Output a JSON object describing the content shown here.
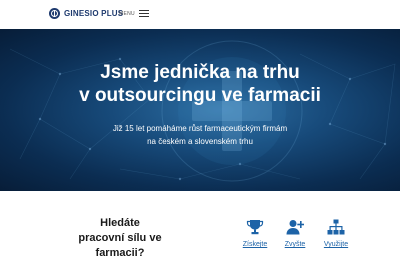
{
  "header": {
    "logo_text": "GINESIO PLUS",
    "menu_label": "MENU"
  },
  "hero": {
    "title_line1": "Jsme jednička na trhu",
    "title_line2": "v outsourcingu ve farmacii",
    "subtitle_line1": "Již 15 let pomáháme růst farmaceutickým firmám",
    "subtitle_line2": "na českém a slovenském trhu"
  },
  "section": {
    "headline_line1": "Hledáte",
    "headline_line2": "pracovní sílu ve",
    "headline_line3": "farmacii?",
    "features": [
      {
        "icon": "trophy-icon",
        "label": "Získejte"
      },
      {
        "icon": "add-user-icon",
        "label": "Zvyšte"
      },
      {
        "icon": "org-chart-icon",
        "label": "Využijte"
      }
    ]
  },
  "colors": {
    "brand": "#1e3a6e",
    "hero_dark": "#0b2d52",
    "icon_blue": "#1d63a7"
  }
}
